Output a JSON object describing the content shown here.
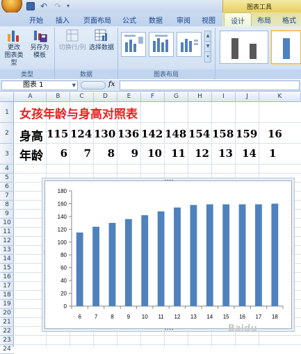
{
  "window": {
    "title_faded": "图表工具",
    "context_label": "图表工具"
  },
  "tabs": [
    "开始",
    "插入",
    "页面布局",
    "公式",
    "数据",
    "审阅",
    "视图",
    "设计",
    "布局",
    "格式"
  ],
  "active_tab": "设计",
  "ribbon": {
    "groups": {
      "type": {
        "label": "类型",
        "buttons": [
          {
            "label_line1": "更改",
            "label_line2": "图表类型",
            "icon": "change-chart-type-icon"
          },
          {
            "label_line1": "另存为",
            "label_line2": "模板",
            "icon": "save-as-template-icon"
          }
        ]
      },
      "data": {
        "label": "数据",
        "buttons": [
          {
            "label": "切换行/列",
            "icon": "switch-row-column-icon",
            "disabled": true
          },
          {
            "label": "选择数据",
            "icon": "select-data-icon",
            "disabled": false
          }
        ]
      },
      "chart_layouts": {
        "label": "图表布局"
      },
      "chart_styles": {
        "label": ""
      }
    }
  },
  "formula_bar": {
    "name_box": "图表 1",
    "fx": "fx",
    "formula": ""
  },
  "columns": [
    "A",
    "B",
    "C",
    "D",
    "E",
    "F",
    "G",
    "H",
    "I",
    "J",
    "K"
  ],
  "rows": [
    "1",
    "2",
    "3",
    "4",
    "5",
    "6",
    "7",
    "8",
    "9",
    "10",
    "11",
    "12",
    "13",
    "14",
    "15",
    "16",
    "17",
    "18",
    "19",
    "20",
    "21",
    "22",
    "23",
    "24"
  ],
  "sheet": {
    "title": "女孩年龄与身高对照表",
    "height_label": "身高",
    "age_label": "年龄",
    "heights": [
      "115",
      "124",
      "130",
      "136",
      "142",
      "148",
      "154",
      "158",
      "159",
      "16"
    ],
    "ages": [
      "6",
      "7",
      "8",
      "9",
      "10",
      "11",
      "12",
      "13",
      "14",
      "1"
    ]
  },
  "chart_data": {
    "type": "bar",
    "categories": [
      "6",
      "7",
      "8",
      "9",
      "10",
      "11",
      "12",
      "13",
      "14",
      "15",
      "16",
      "17",
      "18"
    ],
    "values": [
      115,
      124,
      130,
      136,
      142,
      148,
      154,
      158,
      159,
      159,
      159,
      159,
      160
    ],
    "ylim": [
      0,
      180
    ],
    "yticks": [
      "0",
      "20",
      "40",
      "60",
      "80",
      "100",
      "120",
      "140",
      "160",
      "180"
    ],
    "title": "",
    "xlabel": "",
    "ylabel": "",
    "bar_color": "#4f81bd",
    "grid": false
  },
  "watermark": "Baidu"
}
